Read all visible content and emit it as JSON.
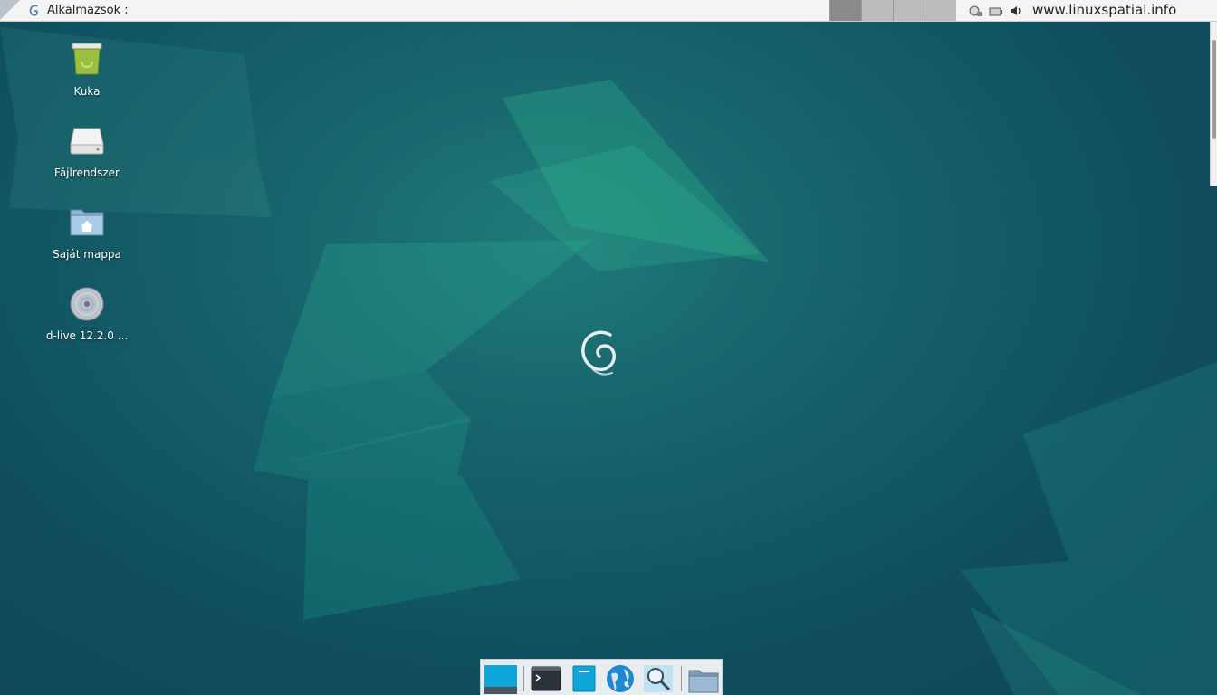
{
  "top_panel": {
    "apps_menu_label": "Alkalmazsok :",
    "clock_text": "www.linuxspatial.info",
    "workspaces": [
      "1",
      "2",
      "3",
      "4"
    ],
    "tray_icons": [
      "network-icon",
      "battery-icon",
      "volume-icon"
    ]
  },
  "desktop_icons": [
    {
      "label": "Kuka",
      "icon": "trash-icon"
    },
    {
      "label": "Fájlrendszer",
      "icon": "drive-icon"
    },
    {
      "label": "Saját mappa",
      "icon": "home-folder-icon"
    },
    {
      "label": "d-live 12.2.0 ...",
      "icon": "disc-icon"
    }
  ],
  "dock": {
    "items": [
      "show-desktop-icon",
      "terminal-icon",
      "file-manager-icon",
      "web-browser-icon",
      "search-icon",
      "folder-icon"
    ]
  },
  "colors": {
    "background": "#0f4d5e",
    "background_light": "#1f7a78",
    "panel": "#f4f4f4",
    "accent": "#0ea5d8"
  }
}
